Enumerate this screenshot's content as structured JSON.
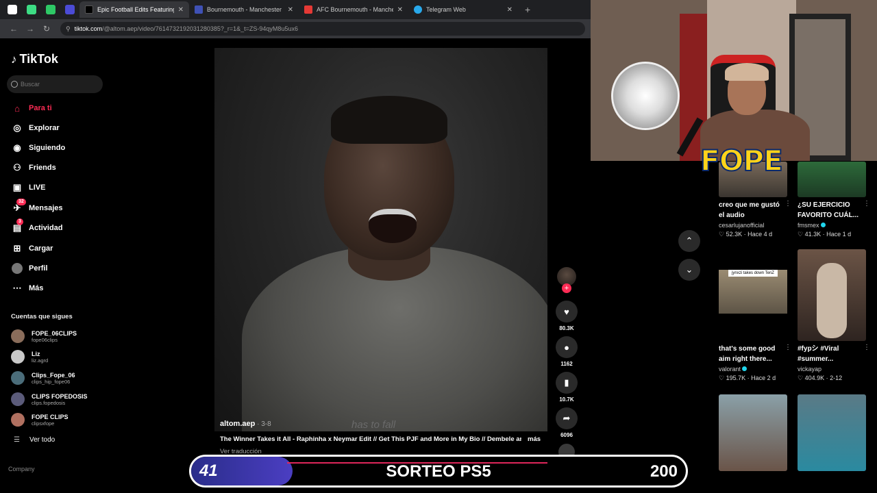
{
  "browser": {
    "tabs": [
      {
        "title": "Epic Football Edits Featuring Ra",
        "active": true,
        "color": "#000000"
      },
      {
        "title": "Bournemouth - Manchester Un",
        "active": false,
        "color": "#3f51b5"
      },
      {
        "title": "AFC Bournemouth - Manchester",
        "active": false,
        "color": "#e53935"
      },
      {
        "title": "Telegram Web",
        "active": false,
        "color": "#29a9eb"
      }
    ],
    "url_host": "tiktok.com",
    "url_path": "/@altom.aep/video/7614732192031280385?_r=1&_t=ZS-94qyM8u5ux6"
  },
  "sidebar": {
    "logo": "TikTok",
    "search_placeholder": "Buscar",
    "nav": [
      {
        "label": "Para ti",
        "icon": "home-icon",
        "glyph": "⌂",
        "color": "#fe2c55"
      },
      {
        "label": "Explorar",
        "icon": "compass-icon",
        "glyph": "◎"
      },
      {
        "label": "Siguiendo",
        "icon": "following-icon",
        "glyph": "◉"
      },
      {
        "label": "Friends",
        "icon": "friends-icon",
        "glyph": "⚇"
      },
      {
        "label": "LIVE",
        "icon": "live-icon",
        "glyph": "▣"
      },
      {
        "label": "Mensajes",
        "icon": "messages-icon",
        "glyph": "✈",
        "badge": "32"
      },
      {
        "label": "Actividad",
        "icon": "activity-icon",
        "glyph": "▤",
        "badge": "3"
      },
      {
        "label": "Cargar",
        "icon": "upload-icon",
        "glyph": "⊞"
      },
      {
        "label": "Perfil",
        "icon": "profile-icon",
        "glyph": "●"
      },
      {
        "label": "Más",
        "icon": "more-icon",
        "glyph": "⋯"
      }
    ],
    "following_title": "Cuentas que sigues",
    "following": [
      {
        "name": "FOPE_06CLIPS",
        "handle": "fope06clips"
      },
      {
        "name": "Liz",
        "handle": "liz.agrd"
      },
      {
        "name": "Clips_Fope_06",
        "handle": "clips_hip_fope06"
      },
      {
        "name": "CLIPS FOPEDOSIS",
        "handle": "clips.fopedosis"
      },
      {
        "name": "FOPE CLIPS",
        "handle": "clipsxfope"
      }
    ],
    "see_all": "Ver todo",
    "company": "Company"
  },
  "video": {
    "lyric": "has to fall",
    "author": "altom.aep",
    "date": " · 3-8",
    "description": "The Winner Takes it All - Raphinha x Neymar Edit // Get This PJF and More in My Bio // Dembele and",
    "more": "más",
    "translate": "Ver traducción",
    "likes": "80.3K",
    "comments": "1162",
    "saves": "10.7K",
    "shares": "6096"
  },
  "feed": [
    {
      "title": "creo que me gustó el audio",
      "user": "cesarlujanofficial",
      "verified": false,
      "views": "52.3K",
      "date": "Hace 4 d"
    },
    {
      "title": "¿SU EJERCICIO FAVORITO CUÁL...",
      "user": "fmsmex",
      "verified": true,
      "views": "41.3K",
      "date": "Hace 1 d"
    },
    {
      "title": "that's some good aim right there...",
      "user": "valorant",
      "verified": true,
      "views": "195.7K",
      "date": "Hace 2 d",
      "thumb_caption": "jynxzi takes down TenZ"
    },
    {
      "title": "#fypシ #Viral #summer...",
      "user": "vickayap",
      "verified": false,
      "views": "404.9K",
      "date": "2-12"
    }
  ],
  "overlay": {
    "left_count": "41",
    "title": "SORTEO PS5",
    "right_count": "200",
    "progress": 0.205
  },
  "webcam_brand": "FOPE"
}
